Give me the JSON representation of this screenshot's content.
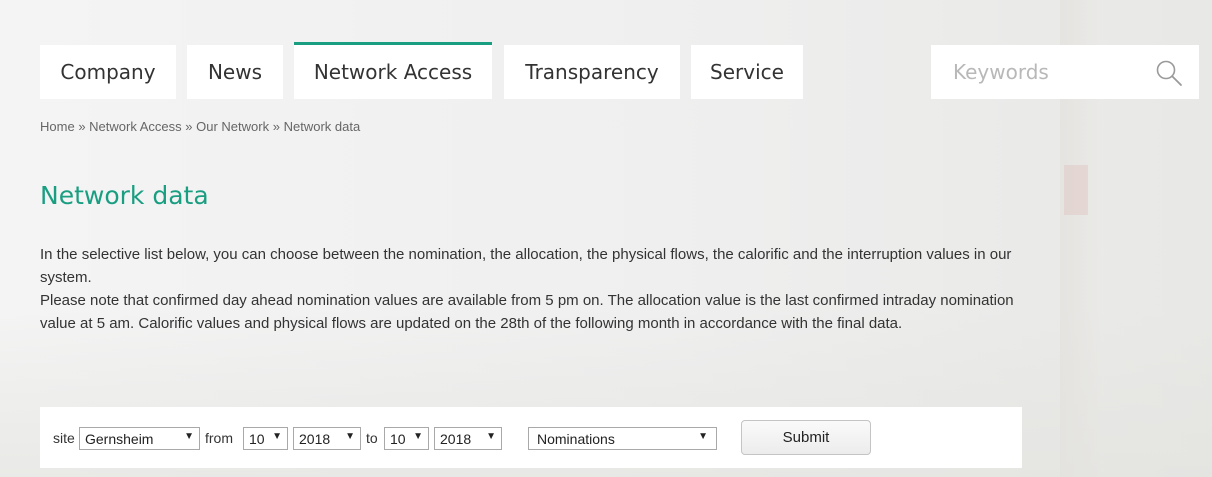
{
  "nav": {
    "tabs": [
      {
        "label": "Company"
      },
      {
        "label": "News"
      },
      {
        "label": "Network Access",
        "active": true
      },
      {
        "label": "Transparency"
      },
      {
        "label": "Service"
      }
    ],
    "accent_color": "#1a9e82"
  },
  "search": {
    "placeholder": "Keywords",
    "value": ""
  },
  "breadcrumb": {
    "items": [
      "Home",
      "Network Access",
      "Our Network",
      "Network data"
    ],
    "separator": "»"
  },
  "page": {
    "title": "Network data",
    "paragraph_1": "In the selective list below, you can choose between the nomination, the allocation, the physical flows, the calorific and the interruption values in our system.",
    "paragraph_2": "Please note that confirmed day ahead nomination values are available from 5 pm on. The allocation value is the last confirmed intraday nomination value at 5 am. Calorific values and physical flows are updated on the 28th of the following month in accordance with the final data."
  },
  "form": {
    "site_label": "site",
    "site_value": "Gernsheim",
    "from_label": "from",
    "from_month": "10",
    "from_year": "2018",
    "to_label": "to",
    "to_month": "10",
    "to_year": "2018",
    "type_value": "Nominations",
    "submit_label": "Submit",
    "arrow": "▼"
  }
}
